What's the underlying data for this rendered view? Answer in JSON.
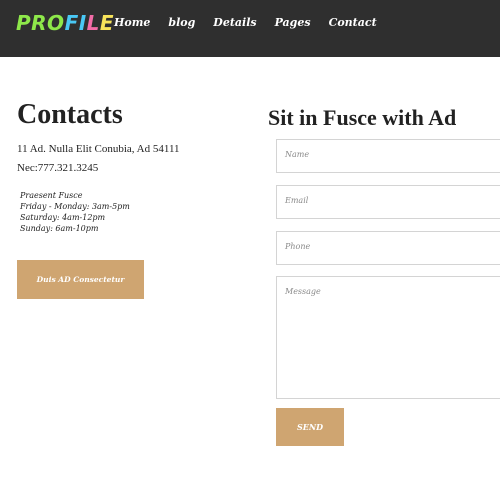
{
  "header": {
    "logo": [
      "PRO",
      "FI",
      "L",
      "E"
    ],
    "nav": [
      "Home",
      "blog",
      "Details",
      "Pages",
      "Contact"
    ]
  },
  "contacts": {
    "title": "Contacts",
    "address": "11 Ad. Nulla Elit Conubia, Ad 54111",
    "phone": "Nec:777.321.3245",
    "hours": [
      "Praesent Fusce",
      "Friday - Monday: 3am-5pm",
      "Saturday: 4am-12pm",
      "Sunday: 6am-10pm"
    ],
    "button": "Duis AD Consectetur"
  },
  "form": {
    "title": "Sit in Fusce with Ad",
    "name_placeholder": "Name",
    "email_placeholder": "Email",
    "phone_placeholder": "Phone",
    "message_placeholder": "Message",
    "send": "SEND"
  },
  "colors": {
    "header_bg": "#2f2f2f",
    "accent": "#cfa571"
  }
}
